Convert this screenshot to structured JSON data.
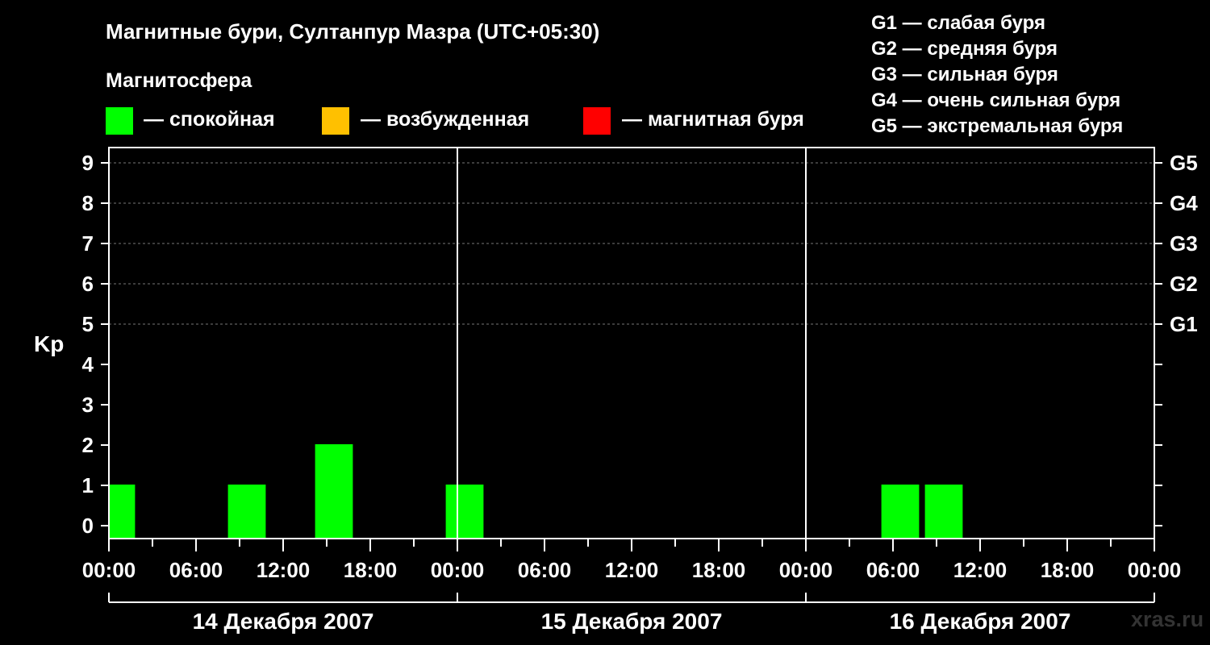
{
  "chart_data": {
    "type": "bar",
    "title": "Магнитные бури, Султанпур Мазра (UTC+05:30)",
    "subtitle": "Магнитосфера",
    "ylabel": "Kp",
    "ylim": [
      0,
      9
    ],
    "yticks": [
      "0",
      "1",
      "2",
      "3",
      "4",
      "5",
      "6",
      "7",
      "8",
      "9"
    ],
    "right_ticks": [
      {
        "kp": 5,
        "label": "G1"
      },
      {
        "kp": 6,
        "label": "G2"
      },
      {
        "kp": 7,
        "label": "G3"
      },
      {
        "kp": 8,
        "label": "G4"
      },
      {
        "kp": 9,
        "label": "G5"
      }
    ],
    "xticks": [
      "00:00",
      "06:00",
      "12:00",
      "18:00",
      "00:00",
      "06:00",
      "12:00",
      "18:00",
      "00:00",
      "06:00",
      "12:00",
      "18:00",
      "00:00"
    ],
    "days": [
      "14 Декабря 2007",
      "15 Декабря 2007",
      "16 Декабря 2007"
    ],
    "grid": true,
    "legend_position": "top",
    "legend": [
      {
        "label": "— спокойная",
        "color": "#00ff00"
      },
      {
        "label": "— возбужденная",
        "color": "#ffc000"
      },
      {
        "label": "— магнитная буря",
        "color": "#ff0000"
      }
    ],
    "storm_levels": [
      "G1 — слабая буря",
      "G2 — средняя буря",
      "G3 — сильная буря",
      "G4 — очень сильная буря",
      "G5 — экстремальная буря"
    ],
    "bars": [
      {
        "start_hour": 0,
        "end_hour": 1.8,
        "kp": 1
      },
      {
        "start_hour": 8.2,
        "end_hour": 10.8,
        "kp": 1
      },
      {
        "start_hour": 14.2,
        "end_hour": 16.8,
        "kp": 2
      },
      {
        "start_hour": 23.2,
        "end_hour": 25.8,
        "kp": 1
      },
      {
        "start_hour": 53.2,
        "end_hour": 55.8,
        "kp": 1
      },
      {
        "start_hour": 56.2,
        "end_hour": 58.8,
        "kp": 1
      }
    ]
  },
  "watermark": "xras.ru"
}
